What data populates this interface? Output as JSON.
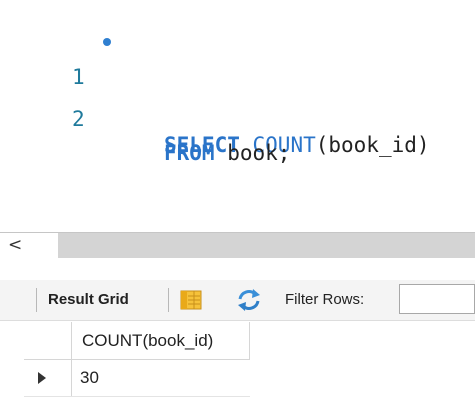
{
  "editor": {
    "lines": [
      {
        "number": "1",
        "has_marker": true,
        "tokens": [
          {
            "text": "SELECT",
            "kind": "keyword"
          },
          {
            "text": " ",
            "kind": "plain"
          },
          {
            "text": "COUNT",
            "kind": "function"
          },
          {
            "text": "(book_id)",
            "kind": "plain"
          }
        ]
      },
      {
        "number": "2",
        "has_marker": false,
        "tokens": [
          {
            "text": "FROM",
            "kind": "keyword"
          },
          {
            "text": " book;",
            "kind": "plain"
          }
        ]
      }
    ]
  },
  "scrollbar": {
    "left_arrow_glyph": "<"
  },
  "result_toolbar": {
    "result_grid_label": "Result Grid",
    "form_icon": "form-view-icon",
    "refresh_icon": "refresh-icon",
    "filter_label": "Filter Rows:",
    "filter_value": ""
  },
  "result_grid": {
    "columns": [
      "COUNT(book_id)"
    ],
    "rows": [
      [
        "30"
      ]
    ]
  },
  "colors": {
    "keyword": "#2a74c9",
    "line_number": "#1f7a9c",
    "marker": "#2f7fd0",
    "scrollbar": "#d4d4d4",
    "toolbar_bg": "#f4f4f4"
  }
}
